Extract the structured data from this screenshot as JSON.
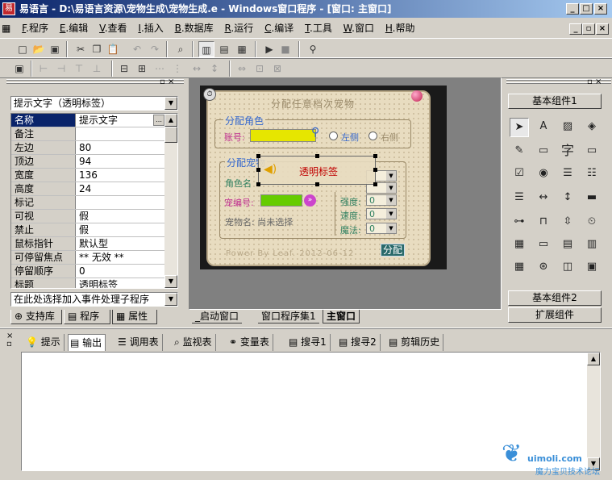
{
  "window": {
    "title": "易语言 - D:\\易语言资源\\宠物生成\\宠物生成.e - Windows窗口程序 - [窗口: 主窗口]",
    "controls": [
      "_",
      "□",
      "×"
    ]
  },
  "menu": [
    {
      "key": "F",
      "label": ".程序"
    },
    {
      "key": "E",
      "label": ".编辑"
    },
    {
      "key": "V",
      "label": ".查看"
    },
    {
      "key": "I",
      "label": ".插入"
    },
    {
      "key": "B",
      "label": ".数据库"
    },
    {
      "key": "R",
      "label": ".运行"
    },
    {
      "key": "C",
      "label": ".编译"
    },
    {
      "key": "T",
      "label": ".工具"
    },
    {
      "key": "W",
      "label": ".窗口"
    },
    {
      "key": "H",
      "label": ".帮助"
    }
  ],
  "toolbar1": [
    "new-icon",
    "open-icon",
    "save-icon",
    "cut-icon",
    "copy-icon",
    "paste-icon",
    "undo-icon",
    "redo-icon",
    "find-icon",
    "layout1-icon",
    "layout2-icon",
    "layout3-icon",
    "run-icon",
    "stop-icon",
    "binoculars-icon"
  ],
  "left_panel": {
    "selector": "提示文字（透明标签）",
    "properties": [
      {
        "name": "名称",
        "value": "提示文字",
        "selected": true
      },
      {
        "name": "备注",
        "value": ""
      },
      {
        "name": "左边",
        "value": "80"
      },
      {
        "name": "顶边",
        "value": "94"
      },
      {
        "name": "宽度",
        "value": "136"
      },
      {
        "name": "高度",
        "value": "24"
      },
      {
        "name": "标记",
        "value": ""
      },
      {
        "name": "可视",
        "value": "假"
      },
      {
        "name": "禁止",
        "value": "假"
      },
      {
        "name": "鼠标指针",
        "value": "默认型"
      },
      {
        "name": "可停留焦点",
        "value": "** 无效 **"
      },
      {
        "name": "停留顺序",
        "value": "0"
      },
      {
        "name": "标题",
        "value": "透明标签"
      }
    ],
    "event_selector": "在此处选择加入事件处理子程序",
    "tabs": [
      "支持库",
      "程序",
      "属性"
    ]
  },
  "designer": {
    "form_title": "分配任意档次宠物",
    "group1": {
      "title": "分配角色",
      "account_label": "账号:",
      "left_opt": "左侧",
      "right_opt": "右侧"
    },
    "group2": {
      "title": "分配宠物",
      "role_label": "角色名",
      "pet_no_label": "宠编号:",
      "pet_name": "宠物名: 尚未选择"
    },
    "stats": [
      {
        "label": "强度:",
        "value": "0"
      },
      {
        "label": "速度:",
        "value": "0"
      },
      {
        "label": "魔法:",
        "value": "0"
      }
    ],
    "transparent_label": "透明标签",
    "footer": "Power By Leaf. 2012-06-12",
    "assign_button": "分配"
  },
  "doc_tabs": [
    "_启动窗口",
    "窗口程序集1",
    "主窗口"
  ],
  "right_panel": {
    "header": "基本组件1",
    "footer1": "基本组件2",
    "footer2": "扩展组件"
  },
  "output_tabs": [
    "提示",
    "输出",
    "调用表",
    "监视表",
    "变量表",
    "搜寻1",
    "搜寻2",
    "剪辑历史"
  ],
  "watermark": {
    "site": "uimoli.com",
    "caption": "魔力宝贝技术论坛"
  }
}
